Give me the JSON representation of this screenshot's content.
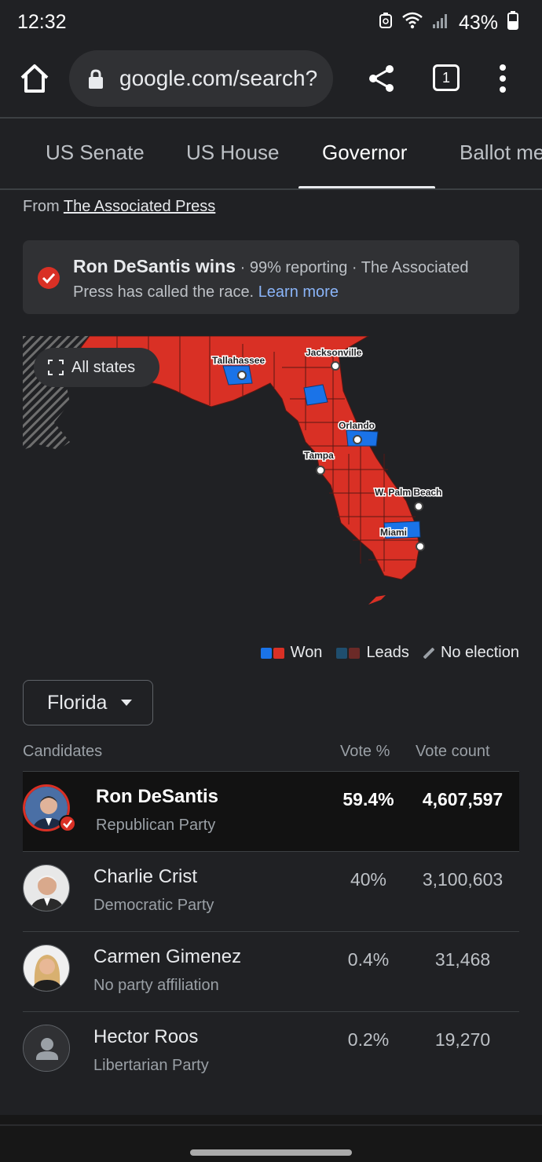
{
  "status_bar": {
    "time": "12:32",
    "battery": "43%"
  },
  "browser": {
    "url": "google.com/search?",
    "tab_count": "1"
  },
  "tabs": [
    {
      "label": "US Senate"
    },
    {
      "label": "US House"
    },
    {
      "label": "Governor"
    },
    {
      "label": "Ballot me"
    }
  ],
  "source": {
    "prefix": "From",
    "name": "The Associated Press"
  },
  "callout": {
    "winner": "Ron DeSantis wins",
    "detail": " · 99% reporting · The Associated Press has called the race. ",
    "link": "Learn more"
  },
  "map": {
    "all_states_label": "All states",
    "cities": [
      "Tallahassee",
      "Jacksonville",
      "Orlando",
      "Tampa",
      "W. Palm Beach",
      "Miami"
    ],
    "colors": {
      "republican": "#d93025",
      "democrat": "#1a73e8",
      "lead_dem": "#1f4e6e",
      "lead_rep": "#6b2a27",
      "no_election": "#5f6368"
    }
  },
  "legend": {
    "won": "Won",
    "leads": "Leads",
    "no_election": "No election"
  },
  "state_selector": {
    "value": "Florida"
  },
  "table": {
    "headers": {
      "candidates": "Candidates",
      "vote_pct": "Vote %",
      "vote_count": "Vote count"
    },
    "rows": [
      {
        "name": "Ron DeSantis",
        "party": "Republican Party",
        "pct": "59.4%",
        "count": "4,607,597",
        "winner": true
      },
      {
        "name": "Charlie Crist",
        "party": "Democratic Party",
        "pct": "40%",
        "count": "3,100,603",
        "winner": false
      },
      {
        "name": "Carmen Gimenez",
        "party": "No party affiliation",
        "pct": "0.4%",
        "count": "31,468",
        "winner": false
      },
      {
        "name": "Hector Roos",
        "party": "Libertarian Party",
        "pct": "0.2%",
        "count": "19,270",
        "winner": false
      }
    ]
  }
}
